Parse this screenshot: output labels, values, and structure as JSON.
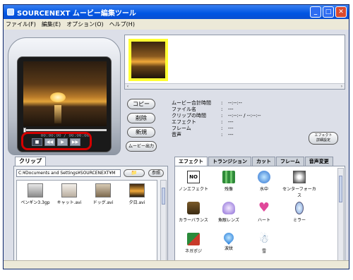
{
  "window": {
    "title": "SOURCENEXT ムービー編集ツール"
  },
  "menu": {
    "items": [
      "ファイル(F)",
      "編集(E)",
      "オプション(O)",
      "ヘルプ(H)"
    ]
  },
  "player": {
    "timecode": "00:00:00 / 00:00:00",
    "controls": [
      "■",
      "◀◀",
      "▶",
      "▶▶"
    ]
  },
  "buttons": {
    "copy": "コピー",
    "delete": "削除",
    "new": "新規",
    "movie_output": "ムービー出力"
  },
  "info": {
    "rows": [
      {
        "label": "ムービー合計時間",
        "value": "--:--:--"
      },
      {
        "label": "ファイル名",
        "value": "---"
      },
      {
        "label": "クリップの時間",
        "value": "--:--:-- / --:--:--"
      },
      {
        "label": "エフェクト",
        "value": "---"
      },
      {
        "label": "フレーム",
        "value": "---"
      },
      {
        "label": "音声",
        "value": "---"
      }
    ],
    "separator": ":",
    "effect_setting_line1": "エフェクト",
    "effect_setting_line2": "詳細設定"
  },
  "clip_panel": {
    "tab": "クリップ",
    "path": "C:¥Documents and Settings¥SOURCENEXT¥M",
    "folder_btn": "📁",
    "ref_btn": "参照",
    "clips": [
      {
        "name": "ペンギン3.3gp"
      },
      {
        "name": "キャット.avi"
      },
      {
        "name": "ドッグ.avi"
      },
      {
        "name": "夕日.avi"
      }
    ]
  },
  "effects_panel": {
    "tabs": [
      "エフェクト",
      "トランジション",
      "カット",
      "フレーム",
      "音声変更"
    ],
    "items": [
      {
        "name": "ノンエフェクト",
        "icon": "no-effect-icon"
      },
      {
        "name": "残像",
        "icon": "afterimage-icon"
      },
      {
        "name": "水中",
        "icon": "underwater-icon"
      },
      {
        "name": "センターフォーカス",
        "icon": "center-focus-icon"
      },
      {
        "name": "カラーバランス",
        "icon": "color-balance-icon"
      },
      {
        "name": "魚眼レンズ",
        "icon": "fisheye-icon"
      },
      {
        "name": "ハート",
        "icon": "heart-icon"
      },
      {
        "name": "ミラー",
        "icon": "mirror-icon"
      },
      {
        "name": "ネガポジ",
        "icon": "negaposi-icon"
      },
      {
        "name": "波紋",
        "icon": "ripple-icon"
      },
      {
        "name": "雪",
        "icon": "snow-icon"
      }
    ]
  },
  "colors": {
    "highlight": "#d40000",
    "title_bar": "#0054e3",
    "thumbnail_selected": "#ffff33"
  }
}
